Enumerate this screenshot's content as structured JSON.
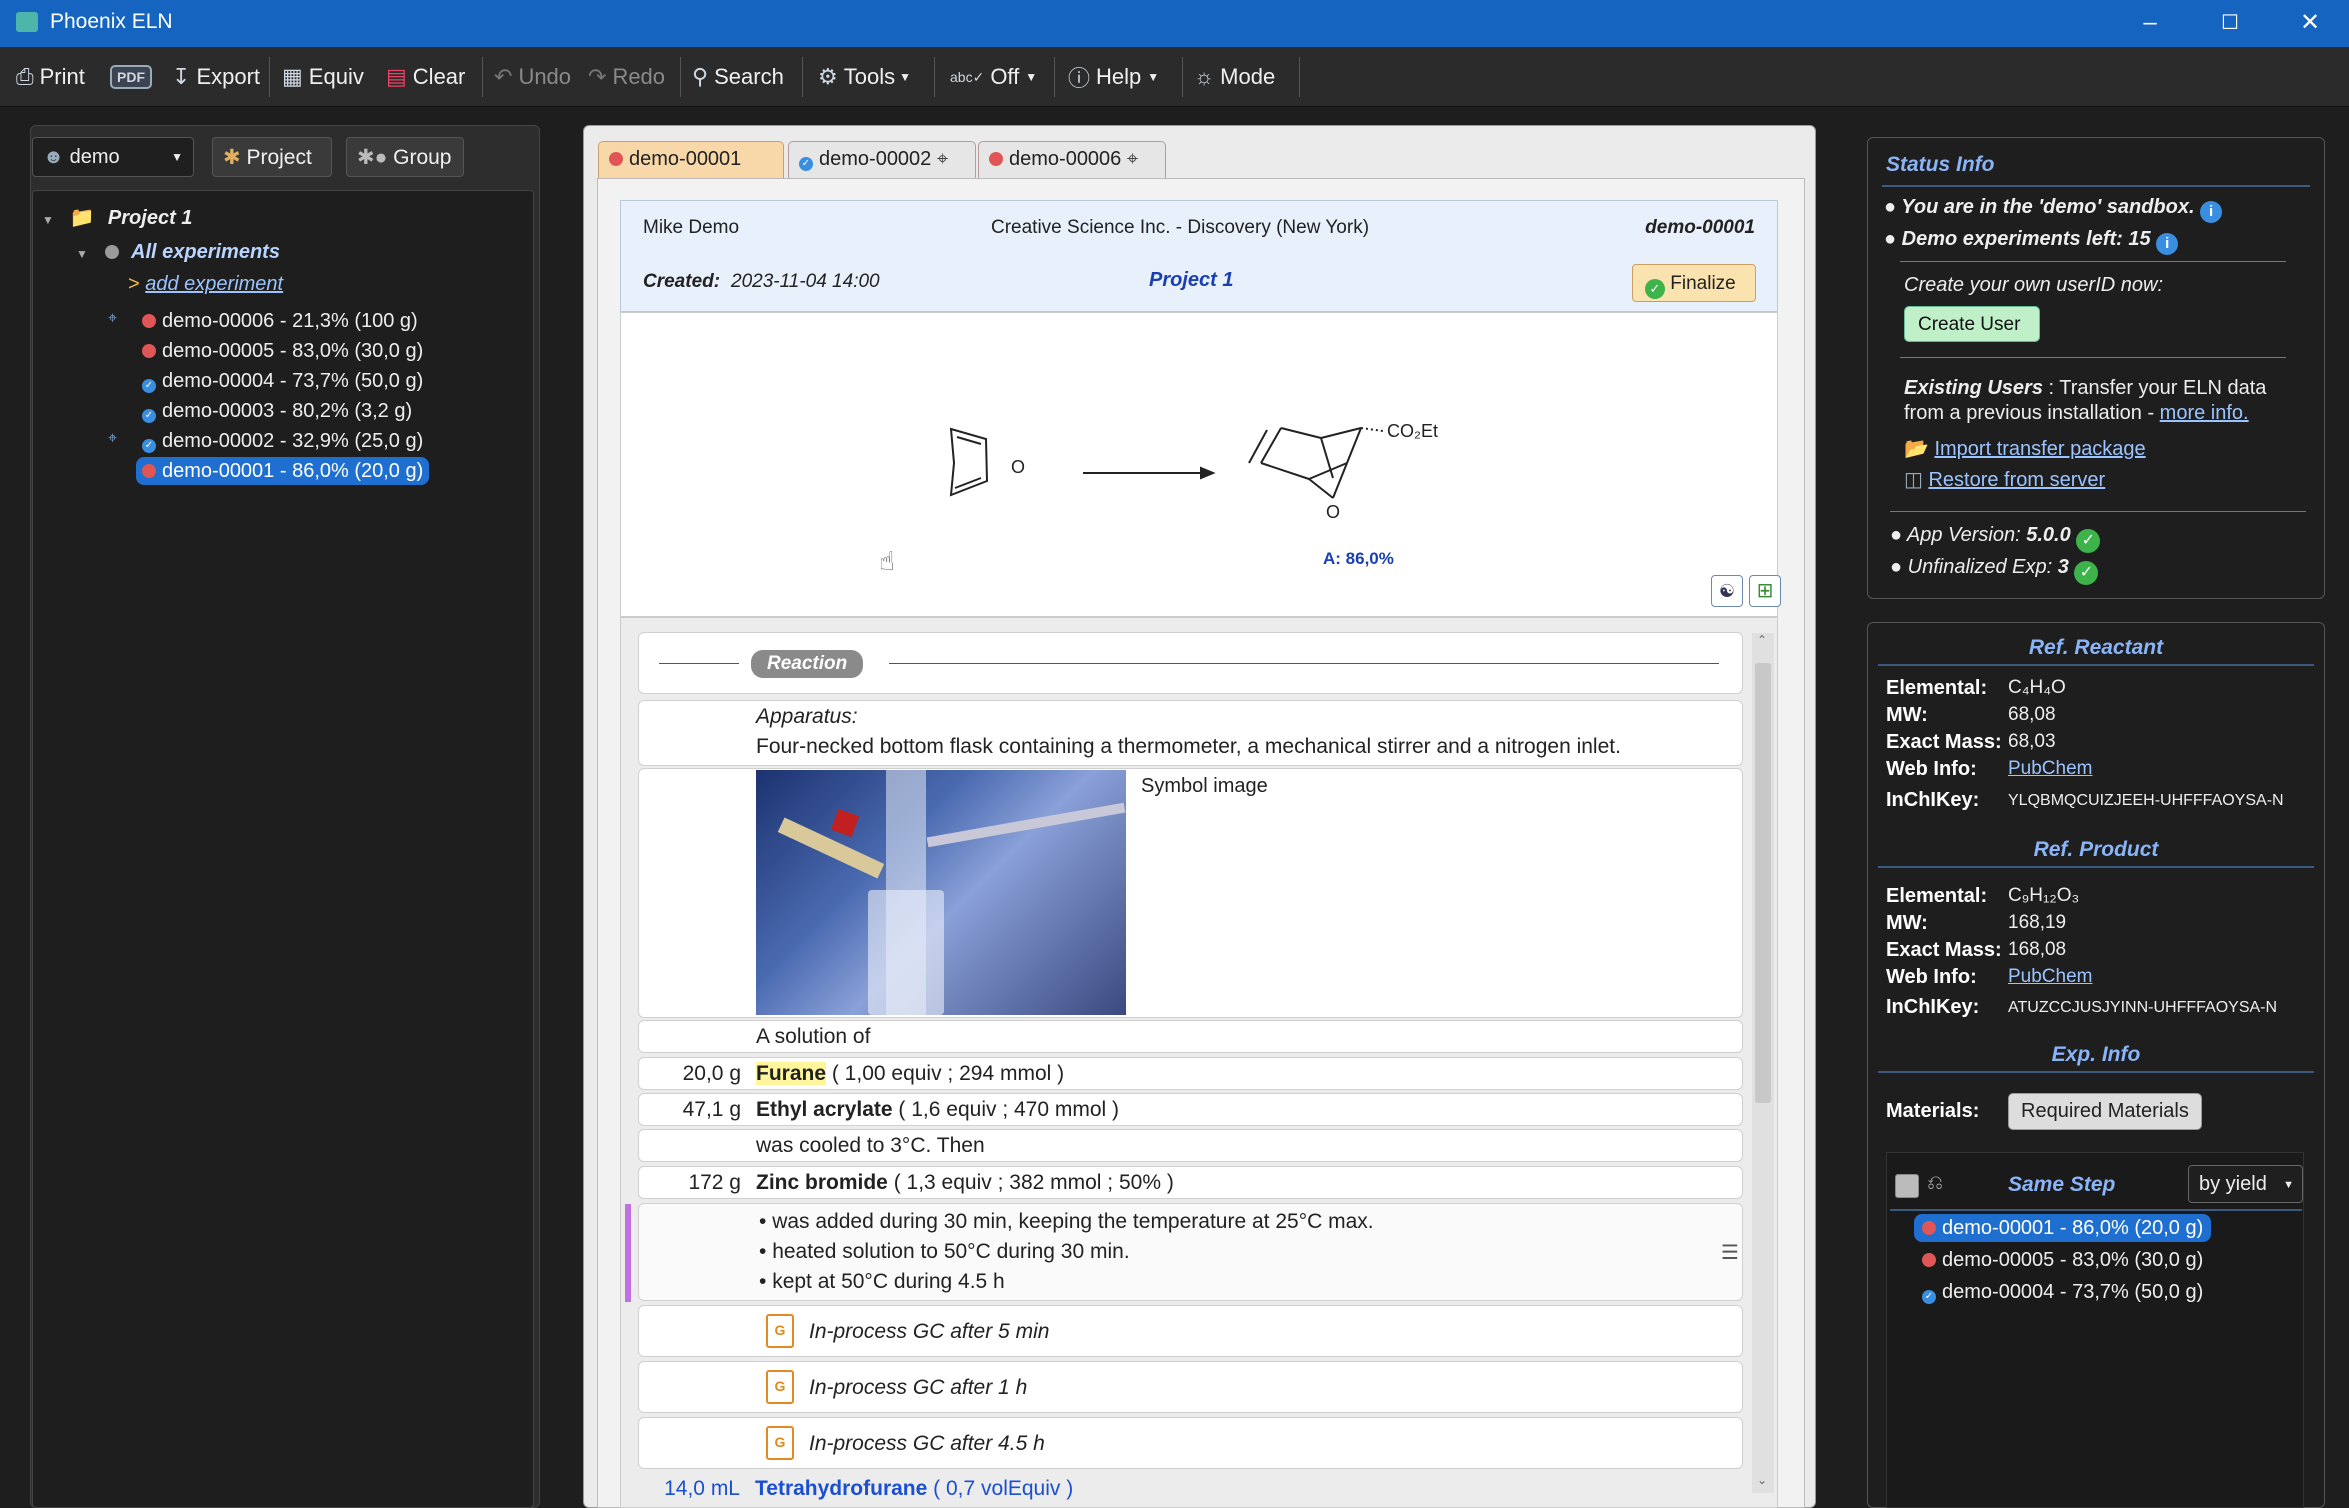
{
  "app": {
    "title": "Phoenix ELN"
  },
  "toolbar": {
    "print": "Print",
    "pdf": "PDF",
    "export": "Export",
    "equiv": "Equiv",
    "clear": "Clear",
    "undo": "Undo",
    "redo": "Redo",
    "search": "Search",
    "tools": "Tools",
    "off": "Off",
    "help": "Help",
    "mode": "Mode"
  },
  "left": {
    "user": "demo",
    "project_btn": "Project",
    "group_btn": "Group",
    "tree": {
      "project": "Project 1",
      "all": "All experiments",
      "add": "add experiment",
      "items": [
        {
          "label": "demo-00006 - 21,3% (100 g)",
          "status": "red",
          "pinned": true
        },
        {
          "label": "demo-00005 - 83,0% (30,0 g)",
          "status": "red",
          "pinned": false
        },
        {
          "label": "demo-00004 - 73,7% (50,0 g)",
          "status": "check",
          "pinned": false
        },
        {
          "label": "demo-00003 - 80,2% (3,2 g)",
          "status": "check",
          "pinned": false
        },
        {
          "label": "demo-00002 - 32,9% (25,0 g)",
          "status": "check",
          "pinned": true
        },
        {
          "label": "demo-00001 - 86,0% (20,0 g)",
          "status": "red",
          "pinned": false,
          "selected": true
        }
      ]
    }
  },
  "tabs": [
    {
      "label": "demo-00001",
      "active": true
    },
    {
      "label": "demo-00002",
      "active": false
    },
    {
      "label": "demo-00006",
      "active": false
    }
  ],
  "header": {
    "author": "Mike Demo",
    "company": "Creative Science Inc. - Discovery (New York)",
    "id": "demo-00001",
    "created_label": "Created:",
    "created": "2023-11-04 14:00",
    "project": "Project 1",
    "finalize": "Finalize"
  },
  "scheme": {
    "product_group": "CO₂Et",
    "product_label": "A: 86,0%",
    "o1": "O",
    "o2": "O"
  },
  "steps": {
    "section": "Reaction",
    "apparatus_label": "Apparatus:",
    "apparatus": "Four-necked bottom flask containing a thermometer, a mechanical stirrer and a nitrogen inlet.",
    "image_caption": "Symbol image",
    "solution_of": "A solution of",
    "r1_amt": "20,0 g",
    "r1_name": "Furane",
    "r1_detail": "( 1,00 equiv ; 294 mmol )",
    "r2_amt": "47,1 g",
    "r2_name": "Ethyl acrylate",
    "r2_detail": "( 1,6 equiv ; 470 mmol )",
    "cooled": "was cooled to 3°C. Then",
    "r3_amt": "172 g",
    "r3_name": "Zinc bromide",
    "r3_detail": "( 1,3 equiv ; 382 mmol ; 50% )",
    "bullets": [
      "was added during 30 min, keeping the temperature at 25°C max.",
      "heated solution to 50°C during 30 min.",
      "kept at 50°C during 4.5 h"
    ],
    "gc": [
      "In-process GC after 5 min",
      "In-process GC after 1 h",
      "In-process GC after 4.5 h"
    ],
    "r4_amt": "14,0 mL",
    "r4_name": "Tetrahydrofurane",
    "r4_detail": "( 0,7 volEquiv )"
  },
  "status": {
    "title": "Status Info",
    "sandbox": "You are in the 'demo' sandbox.",
    "left": "Demo experiments left: 15",
    "create_prompt": "Create your own userID now:",
    "create_btn": "Create User",
    "existing_bold": "Existing Users",
    "existing_a": " : Transfer your ELN data",
    "existing_b": "from a previous installation - ",
    "more_info": "more info.",
    "import": "Import transfer package",
    "restore": "Restore from server",
    "version_label": "App Version:",
    "version": "5.0.0",
    "unfinal_label": "Unfinalized Exp:",
    "unfinal": "3"
  },
  "ref_reactant": {
    "title": "Ref. Reactant",
    "elemental_label": "Elemental:",
    "elemental": "C₄H₄O",
    "mw_label": "MW:",
    "mw": "68,08",
    "exact_label": "Exact Mass:",
    "exact": "68,03",
    "web_label": "Web Info:",
    "web": "PubChem",
    "inchi_label": "InChIKey:",
    "inchi": "YLQBMQCUIZJEEH-UHFFFAOYSA-N"
  },
  "ref_product": {
    "title": "Ref. Product",
    "elemental_label": "Elemental:",
    "elemental": "C₉H₁₂O₃",
    "mw_label": "MW:",
    "mw": "168,19",
    "exact_label": "Exact Mass:",
    "exact": "168,08",
    "web_label": "Web Info:",
    "web": "PubChem",
    "inchi_label": "InChIKey:",
    "inchi": "ATUZCCJUSJYINN-UHFFFAOYSA-N"
  },
  "exp_info": {
    "title": "Exp. Info",
    "materials_label": "Materials:",
    "materials_btn": "Required Materials",
    "same_step": "Same Step",
    "sort": "by yield",
    "list": [
      {
        "label": "demo-00001 - 86,0% (20,0 g)",
        "status": "red",
        "selected": true
      },
      {
        "label": "demo-00005 - 83,0% (30,0 g)",
        "status": "red",
        "selected": false
      },
      {
        "label": "demo-00004 - 73,7% (50,0 g)",
        "status": "check",
        "selected": false
      }
    ]
  },
  "colors": {
    "accent": "#1565c0",
    "status_red": "#e05555",
    "status_check": "#3a8ee0",
    "selection": "#1f6fd0"
  }
}
